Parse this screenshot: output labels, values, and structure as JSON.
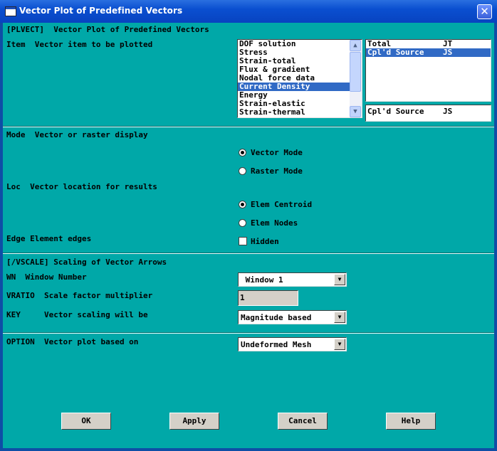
{
  "window": {
    "title": "Vector Plot of Predefined Vectors",
    "close_glyph": "✕"
  },
  "header": {
    "command": "[PLVECT]  Vector Plot of Predefined Vectors"
  },
  "item": {
    "label": "Item  Vector item to be plotted",
    "categories": [
      "DOF solution",
      "Stress",
      "Strain-total",
      "Flux & gradient",
      "Nodal force data",
      "Current Density",
      "Energy",
      "Strain-elastic",
      "Strain-thermal"
    ],
    "selected_category": "Current Density",
    "components": [
      "Total           JT",
      "Cpl'd Source    JS"
    ],
    "selected_component": "Cpl'd Source    JS",
    "selection_text": "Cpl'd Source    JS"
  },
  "mode": {
    "label": "Mode  Vector or raster display",
    "options": [
      "Vector Mode",
      "Raster Mode"
    ],
    "selected": "Vector Mode"
  },
  "loc": {
    "label": "Loc  Vector location for results",
    "options": [
      "Elem Centroid",
      "Elem Nodes"
    ],
    "selected": "Elem Centroid"
  },
  "edge": {
    "label": "Edge Element edges",
    "checkbox_label": "Hidden",
    "checked": false
  },
  "vscale": {
    "header": "[/VSCALE] Scaling of Vector Arrows"
  },
  "wn": {
    "label": "WN  Window Number",
    "value": " Window 1"
  },
  "vratio": {
    "label": "VRATIO  Scale factor multiplier",
    "value": "1"
  },
  "key": {
    "label": "KEY     Vector scaling will be",
    "value": "Magnitude based"
  },
  "option": {
    "label": "OPTION  Vector plot based on",
    "value": "Undeformed Mesh"
  },
  "buttons": {
    "ok": "OK",
    "apply": "Apply",
    "cancel": "Cancel",
    "help": "Help"
  },
  "colors": {
    "dialog_bg": "#00a8a8",
    "selection": "#316ac5",
    "titlebar": "#0a4fd0"
  },
  "icons": {
    "scroll_up": "up-arrow-icon",
    "scroll_down": "down-arrow-icon",
    "combo": "chevron-down-icon"
  }
}
